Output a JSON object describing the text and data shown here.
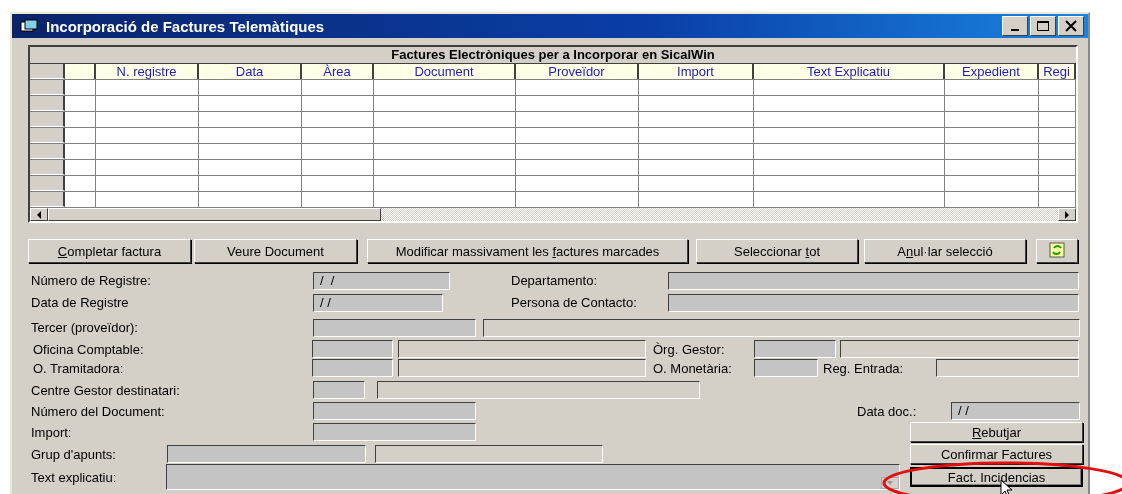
{
  "window": {
    "title": "Incorporació de Factures Telemàtiques"
  },
  "grid": {
    "caption": "Factures Electròniques per a Incorporar en SicalWin",
    "columns": [
      "N. registre",
      "Data",
      "Àrea",
      "Document",
      "Proveïdor",
      "Import",
      "Text Explicatiu",
      "Expedient",
      "Regi"
    ]
  },
  "toolbar": [
    {
      "key": "C",
      "after": "ompletar factura"
    },
    {
      "label": "Veure Document"
    },
    {
      "before": "Modificar massivament les ",
      "key": "f",
      "after": "actures marcades"
    },
    {
      "before": "Seleccionar ",
      "key": "t",
      "after": "ot"
    },
    {
      "before": "A",
      "key": "n",
      "after": "ul·lar selecció"
    },
    {
      "kind": "refresh"
    }
  ],
  "form": [
    {
      "items": [
        {
          "kind": "label",
          "text": "Número de Registre:"
        },
        {
          "kind": "field",
          "value": "/  /"
        },
        {
          "kind": "label",
          "text": "Departamento:"
        },
        {
          "kind": "field"
        }
      ]
    },
    {
      "items": [
        {
          "kind": "label",
          "text": "Data de Registre"
        },
        {
          "kind": "field",
          "value": "/ /"
        },
        {
          "kind": "label",
          "text": "Persona de Contacto:"
        },
        {
          "kind": "field"
        }
      ]
    },
    {
      "items": [
        {
          "kind": "label",
          "text": "Tercer (proveïdor):"
        },
        {
          "kind": "field"
        },
        {
          "kind": "box"
        }
      ]
    },
    {
      "items": [
        {
          "kind": "label",
          "text": "Oficina Comptable:"
        },
        {
          "kind": "field"
        },
        {
          "kind": "box"
        },
        {
          "kind": "label",
          "text": "Òrg. Gestor:"
        },
        {
          "kind": "field"
        },
        {
          "kind": "box"
        }
      ]
    },
    {
      "items": [
        {
          "kind": "label",
          "text": "O. Tramitadora:"
        },
        {
          "kind": "field"
        },
        {
          "kind": "box"
        },
        {
          "kind": "label",
          "text": "O. Monetària:"
        },
        {
          "kind": "field"
        },
        {
          "kind": "label",
          "text": "Reg. Entrada:"
        },
        {
          "kind": "box"
        }
      ]
    },
    {
      "items": [
        {
          "kind": "label",
          "text": "Centre Gestor destinatari:"
        },
        {
          "kind": "field"
        },
        {
          "kind": "box"
        }
      ]
    },
    {
      "items": [
        {
          "kind": "label",
          "text": "Número del Document:"
        },
        {
          "kind": "field"
        },
        {
          "kind": "label",
          "text": "Data doc.:"
        },
        {
          "kind": "field",
          "value": "/ /"
        }
      ]
    },
    {
      "items": [
        {
          "kind": "label",
          "text": "Import:"
        },
        {
          "kind": "field"
        },
        {
          "kind": "button",
          "key": "R",
          "after": "ebutjar",
          "focused": false
        }
      ]
    },
    {
      "items": [
        {
          "kind": "label",
          "text": "Grup d'apunts:"
        },
        {
          "kind": "field"
        },
        {
          "kind": "box"
        },
        {
          "kind": "button",
          "label": "Confirmar Factures",
          "focused": false
        }
      ]
    },
    {
      "items": [
        {
          "kind": "label",
          "text": "Text explicatiu:"
        },
        {
          "kind": "textarea"
        },
        {
          "kind": "button",
          "label": "Fact. Incidencias",
          "focused": true
        }
      ]
    }
  ]
}
